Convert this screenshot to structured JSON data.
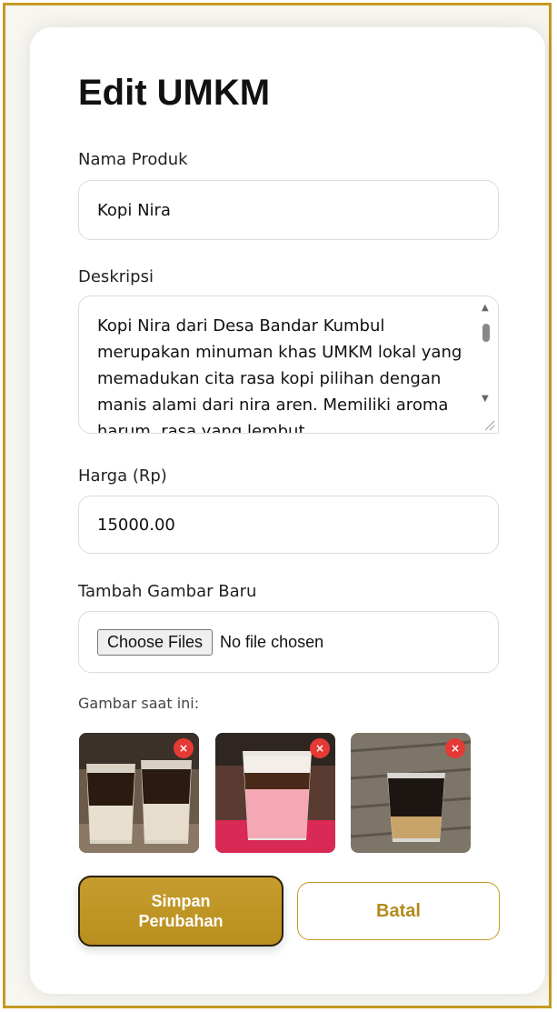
{
  "form": {
    "title": "Edit UMKM",
    "nama_produk": {
      "label": "Nama Produk",
      "value": "Kopi Nira"
    },
    "deskripsi": {
      "label": "Deskripsi",
      "value": "Kopi Nira dari Desa Bandar Kumbul merupakan minuman khas UMKM lokal yang memadukan cita rasa kopi pilihan dengan manis alami dari nira aren. Memiliki aroma harum, rasa yang lembut"
    },
    "harga": {
      "label": "Harga (Rp)",
      "value": "15000.00"
    },
    "gambar_baru": {
      "label": "Tambah Gambar Baru",
      "button": "Choose Files",
      "status": "No file chosen"
    },
    "gambar_saat_ini": {
      "label": "Gambar saat ini:",
      "delete_symbol": "×",
      "images": [
        {
          "icon": "coffee-photo-1"
        },
        {
          "icon": "coffee-photo-2"
        },
        {
          "icon": "coffee-photo-3"
        }
      ]
    },
    "buttons": {
      "save": "Simpan Perubahan",
      "cancel": "Batal"
    }
  },
  "colors": {
    "accent": "#c49a22",
    "delete": "#e53935"
  }
}
